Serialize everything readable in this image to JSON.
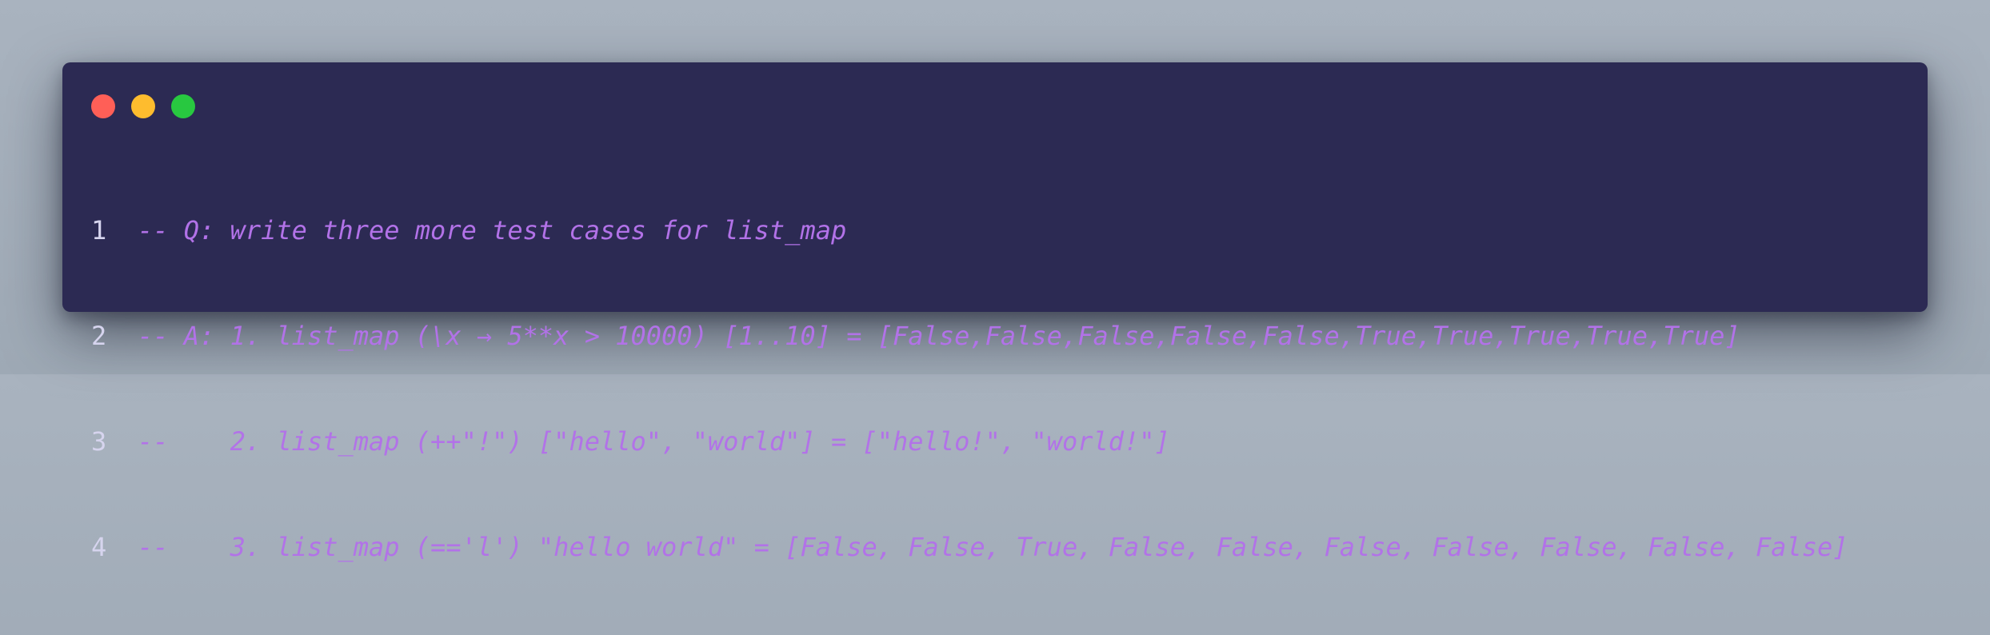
{
  "window": {
    "controls": {
      "close_color": "#ff5f57",
      "minimize_color": "#febc2e",
      "maximize_color": "#28c840"
    },
    "lines": [
      {
        "number": "1",
        "text": "-- Q: write three more test cases for list_map"
      },
      {
        "number": "2",
        "text": "-- A: 1. list_map (\\x → 5**x > 10000) [1..10] = [False,False,False,False,False,True,True,True,True,True]"
      },
      {
        "number": "3",
        "text": "--    2. list_map (++\"!\") [\"hello\", \"world\"] = [\"hello!\", \"world!\"]"
      },
      {
        "number": "4",
        "text": "--    3. list_map (=='l') \"hello world\" = [False, False, True, False, False, False, False, False, False, False]"
      }
    ]
  },
  "colors": {
    "background": "#a6b0bc",
    "window_background": "#2c2a53",
    "code_text": "#b272e8",
    "line_number": "#d6d4ee"
  }
}
